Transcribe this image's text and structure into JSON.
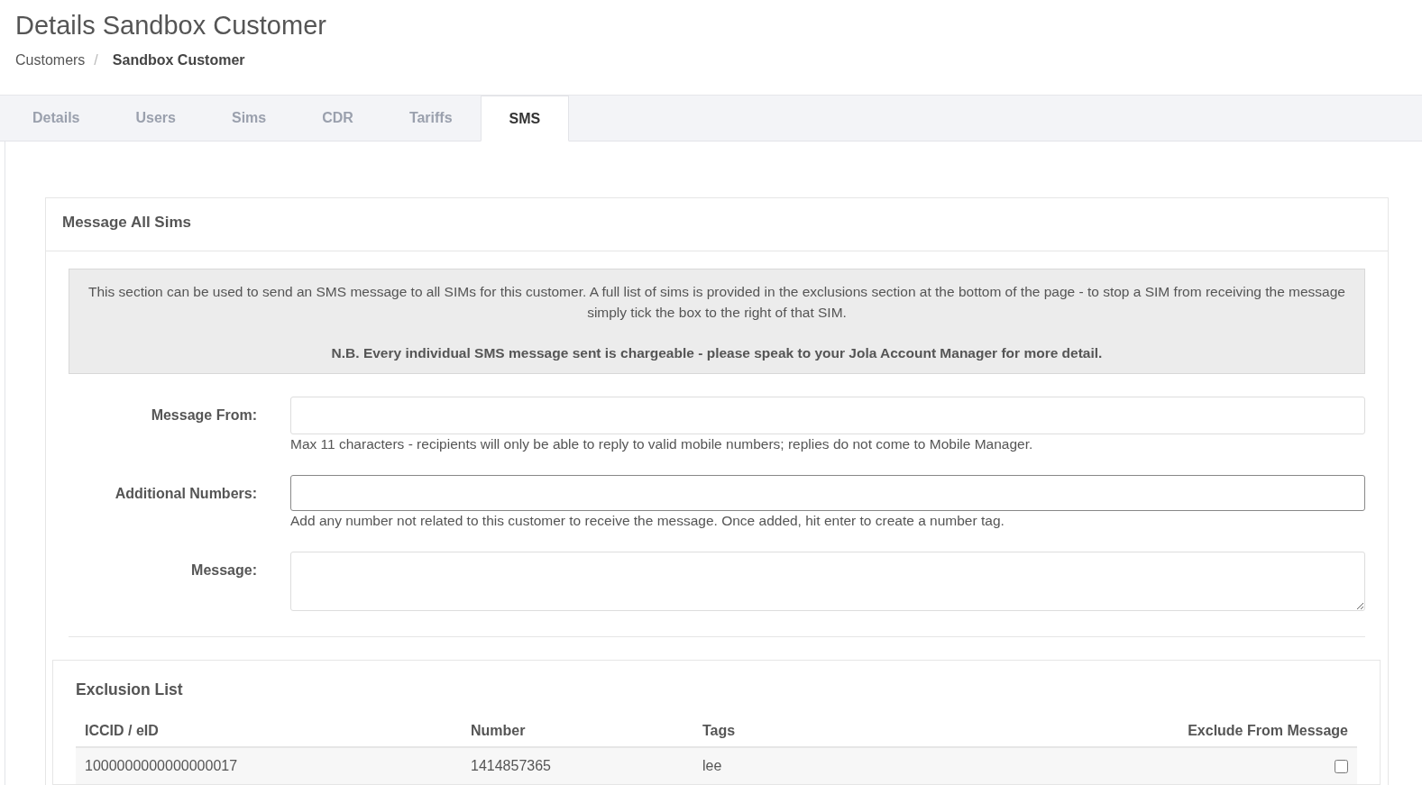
{
  "page": {
    "title": "Details Sandbox Customer"
  },
  "breadcrumb": [
    {
      "label": "Customers",
      "kind": "link"
    },
    {
      "label": "/",
      "kind": "separator"
    },
    {
      "label": "Sandbox Customer",
      "kind": "current"
    }
  ],
  "tabs": [
    {
      "label": "Details",
      "selected": false
    },
    {
      "label": "Users",
      "selected": false
    },
    {
      "label": "Sims",
      "selected": false
    },
    {
      "label": "CDR",
      "selected": false
    },
    {
      "label": "Tariffs",
      "selected": false
    },
    {
      "label": "SMS",
      "selected": true
    }
  ],
  "card": {
    "title": "Message All Sims",
    "notice": {
      "text": "This section can be used to send an SMS message to all SIMs for this customer. A full list of sims is provided in the exclusions section at the bottom of the page - to stop a SIM from receiving the message simply tick the box to the right of that SIM.",
      "warning": "N.B. Every individual SMS message sent is chargeable - please speak to your Jola Account Manager for more detail."
    },
    "fields": [
      {
        "label": "Message From:",
        "kind": "input",
        "focused": false,
        "help": "Max 11 characters - recipients will only be able to reply to valid mobile numbers; replies do not come to Mobile Manager."
      },
      {
        "label": "Additional Numbers:",
        "kind": "input",
        "focused": true,
        "help": "Add any number not related to this customer to receive the message. Once added, hit enter to create a number tag."
      },
      {
        "label": "Message:",
        "kind": "textarea",
        "focused": false
      }
    ],
    "exclusion_list": {
      "title": "Exclusion List",
      "columns": [
        "ICCID / eID",
        "Number",
        "Tags",
        "Exclude From Message"
      ],
      "rows": [
        {
          "iccid": "1000000000000000017",
          "number": "1414857365",
          "tags": "lee",
          "checked": false
        }
      ]
    }
  }
}
